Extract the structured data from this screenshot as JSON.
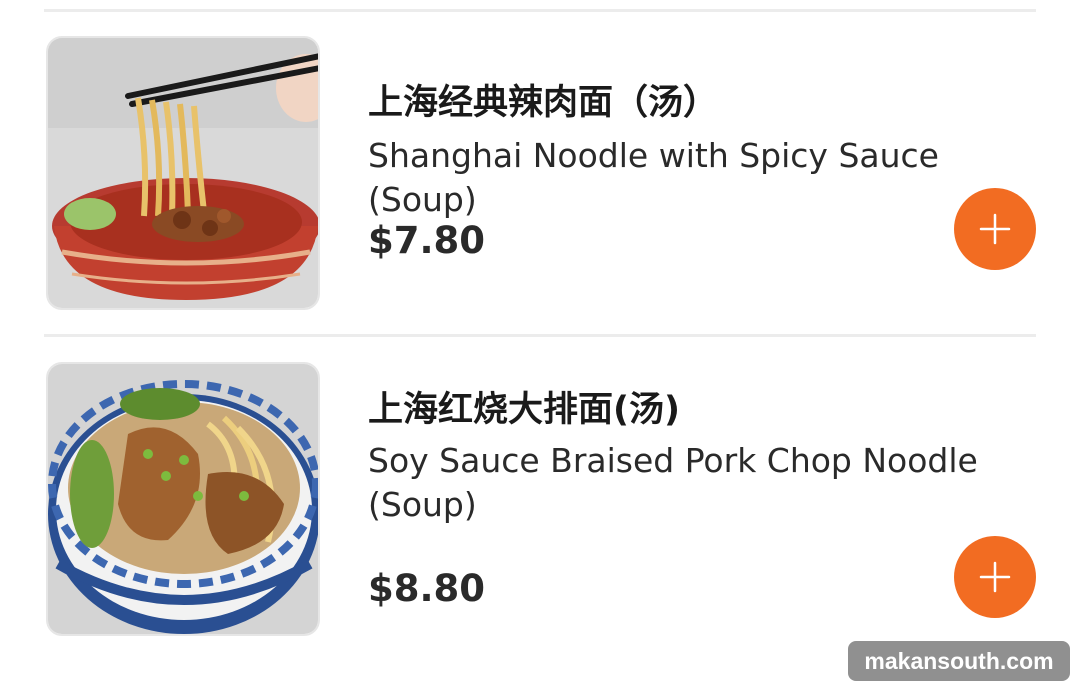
{
  "menu": {
    "items": [
      {
        "name_cn": "上海经典辣肉面（汤）",
        "name_en": "Shanghai Noodle with Spicy Sauce (Soup)",
        "price": "$7.80",
        "add_icon": "plus-icon"
      },
      {
        "name_cn": "上海红烧大排面(汤)",
        "name_en": "Soy Sauce Braised Pork Chop Noodle (Soup)",
        "price": "$8.80",
        "add_icon": "plus-icon"
      }
    ]
  },
  "watermark": "makansouth.com",
  "colors": {
    "accent": "#f26c22",
    "divider": "#ececec"
  }
}
